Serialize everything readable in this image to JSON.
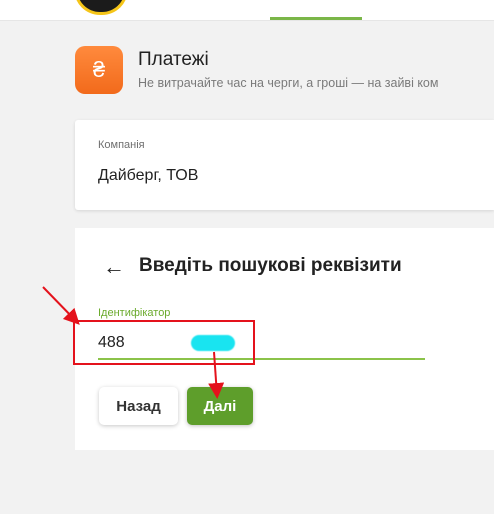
{
  "header": {
    "title": "Платежі",
    "subtitle": "Не витрачайте час на черги, а гроші — на зайві ком",
    "icon": "hryvnia-icon",
    "icon_glyph": "₴"
  },
  "company": {
    "label": "Компанія",
    "value": "Дайберг, ТОВ"
  },
  "search": {
    "back_icon": "arrow-left-icon",
    "back_glyph": "←",
    "title": "Введіть пошукові реквізити",
    "field_label": "Ідентифікатор",
    "field_value": "488"
  },
  "buttons": {
    "back_label": "Назад",
    "next_label": "Далі"
  },
  "colors": {
    "accent_green": "#5e9e2b",
    "orange": "#f26a1b",
    "annotation_red": "#e4121c",
    "redaction": "#19e4f0"
  }
}
